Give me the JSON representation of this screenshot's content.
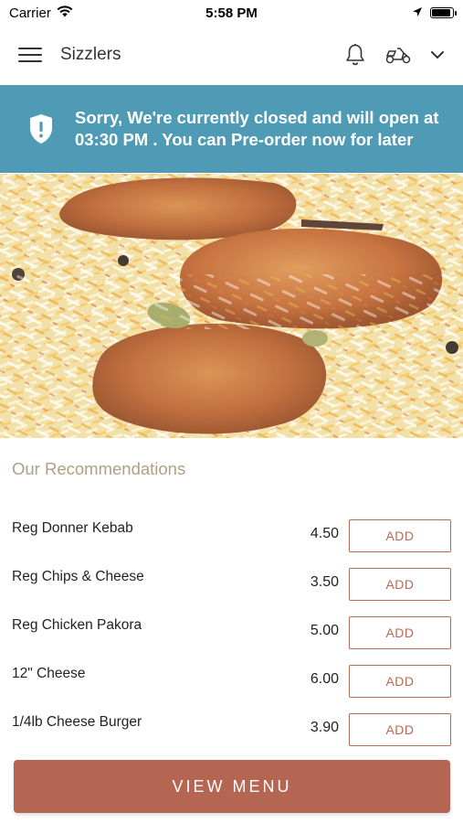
{
  "status_bar": {
    "carrier": "Carrier",
    "time": "5:58 PM",
    "battery_level": 0.9
  },
  "nav": {
    "title": "Sizzlers",
    "icons": [
      "menu-icon",
      "bell-icon",
      "scooter-icon",
      "chevron-down-icon"
    ]
  },
  "banner": {
    "message": "Sorry, We're currently closed and will open at 03:30 PM . You can Pre-order now for later",
    "icon": "shield-alert-icon",
    "color": "#4f9bb5"
  },
  "recommendations": {
    "title": "Our Recommendations",
    "add_label": "ADD",
    "items": [
      {
        "name": "Reg Donner Kebab",
        "price": "4.50"
      },
      {
        "name": "Reg Chips & Cheese",
        "price": "3.50"
      },
      {
        "name": "Reg Chicken Pakora",
        "price": "5.00"
      },
      {
        "name": "12\" Cheese",
        "price": "6.00"
      },
      {
        "name": "1/4lb Cheese Burger",
        "price": "3.90"
      }
    ]
  },
  "footer": {
    "view_menu_label": "VIEW MENU"
  },
  "colors": {
    "accent": "#b56652",
    "banner": "#4f9bb5",
    "section_title": "#b0a07f"
  }
}
